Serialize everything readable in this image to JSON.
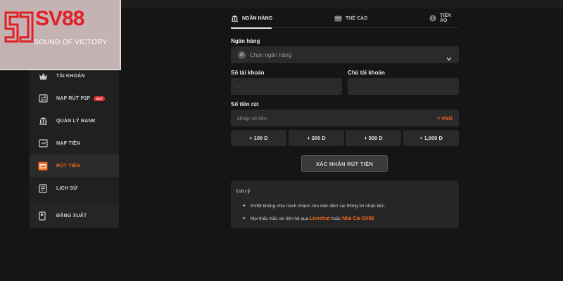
{
  "brand": {
    "name": "SV88",
    "tagline": "SOUND OF VICTORY",
    "colors": {
      "accent": "#f26b1d",
      "brand_red": "#e01f26",
      "bg": "#151515",
      "panel": "#202020"
    }
  },
  "sidebar": {
    "items": [
      {
        "label": "TÀI KHOẢN",
        "icon": "crown-icon"
      },
      {
        "label": "NẠP RÚT P2P",
        "icon": "transfer-icon",
        "badge": "HOT"
      },
      {
        "label": "QUẢN LÝ BANK",
        "icon": "bank-icon"
      },
      {
        "label": "NẠP TIỀN",
        "icon": "deposit-icon"
      },
      {
        "label": "RÚT TIỀN",
        "icon": "withdraw-icon",
        "active": true
      },
      {
        "label": "LỊCH SỬ",
        "icon": "history-icon"
      }
    ],
    "logout": {
      "label": "ĐĂNG XUẤT",
      "icon": "logout-icon"
    }
  },
  "tabs": [
    {
      "label": "NGÂN HÀNG",
      "icon": "bank-icon",
      "active": true
    },
    {
      "label": "THẺ CÀO",
      "icon": "card-icon"
    },
    {
      "label": "TIỀN ẢO",
      "icon": "coin-icon"
    }
  ],
  "form": {
    "bank_label": "Ngân hàng",
    "bank_placeholder": "Chọn ngân hàng",
    "account_number_label": "Số tài khoản",
    "account_number_value": "-",
    "account_holder_label": "Chủ tài khoản",
    "account_holder_value": "-",
    "amount_label": "Số tiền rút",
    "amount_placeholder": "Nhập số tiền",
    "amount_unit": "= VND",
    "quick_amounts": [
      "+ 100 D",
      "+ 200 D",
      "+ 500 D",
      "+ 1,000 D"
    ],
    "submit_label": "XÁC NHẬN RÚT TIỀN"
  },
  "note": {
    "title": "Lưu ý",
    "line1": "SV88 không chịu trách nhiệm cho việc điền sai thông tin nhận tiền.",
    "line2_prefix": "Mọi thắc mắc xin liên hệ qua",
    "line2_link1": "Livechat",
    "line2_middle": "hoặc",
    "line2_link2": "Nhà Cái SV88"
  }
}
